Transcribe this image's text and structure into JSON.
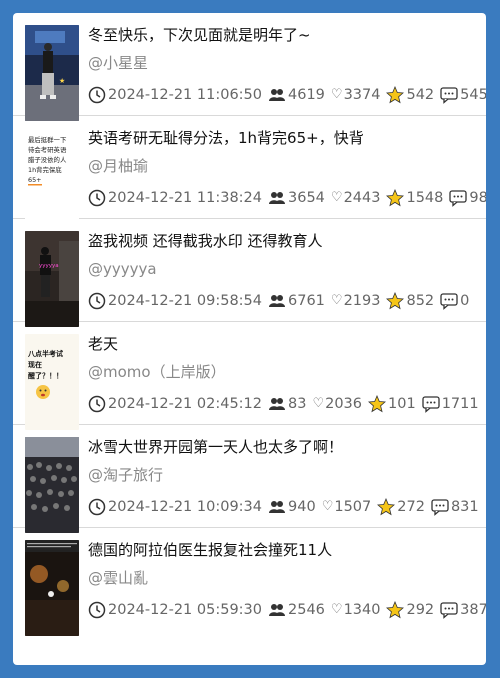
{
  "posts": [
    {
      "title": "冬至快乐，下次见面就是明年了~",
      "author": "@小星星",
      "time": "2024-12-21 11:06:50",
      "views": "4619",
      "likes": "3374",
      "favorites": "542",
      "comments": "545",
      "thumb_kind": "night-stage"
    },
    {
      "title": "英语考研无耻得分法，1h背完65+，快背",
      "author": "@月柚瑜",
      "time": "2024-12-21 11:38:24",
      "views": "3654",
      "likes": "2443",
      "favorites": "1548",
      "comments": "98",
      "thumb_kind": "text-card",
      "thumb_text": [
        "最后挺群一下",
        "待会考研英语",
        "腊子没依的人",
        "1h背完保底",
        "65+"
      ]
    },
    {
      "title": "盗我视频 还得截我水印 还得教育人",
      "author": "@yyyyya",
      "time": "2024-12-21 09:58:54",
      "views": "6761",
      "likes": "2193",
      "favorites": "852",
      "comments": "0",
      "thumb_kind": "dark-room",
      "thumb_text": [
        "yyyyya"
      ]
    },
    {
      "title": "老天",
      "author": "@momo（上岸版）",
      "time": "2024-12-21 02:45:12",
      "views": "83",
      "likes": "2036",
      "favorites": "101",
      "comments": "1711",
      "thumb_kind": "meme-card",
      "thumb_text": [
        "八点半考试",
        "现在",
        "醒了？！！"
      ]
    },
    {
      "title": "冰雪大世界开园第一天人也太多了啊！",
      "author": "@淘子旅行",
      "time": "2024-12-21 10:09:34",
      "views": "940",
      "likes": "1507",
      "favorites": "272",
      "comments": "831",
      "thumb_kind": "crowd"
    },
    {
      "title": "德国的阿拉伯医生报复社会撞死11人",
      "author": "@雲山亂",
      "time": "2024-12-21 05:59:30",
      "views": "2546",
      "likes": "1340",
      "favorites": "292",
      "comments": "387",
      "thumb_kind": "night-street"
    }
  ],
  "colors": {
    "background": "#3a7bbf",
    "panel": "#ffffff",
    "title_text": "#111111",
    "meta_text": "#888888",
    "star": "#f5c518"
  },
  "icons": [
    "clock-icon",
    "views-icon",
    "heart-icon",
    "star-icon",
    "comment-icon"
  ]
}
